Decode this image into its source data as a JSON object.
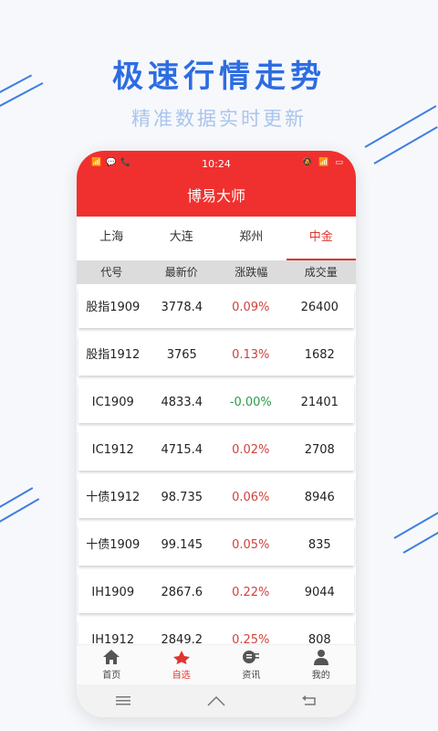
{
  "headline": "极速行情走势",
  "subline": "精准数据实时更新",
  "colors": {
    "brand": "#f0302e",
    "accent": "#2d6de2",
    "up": "#d0423e",
    "flat": "#2f9a45"
  },
  "status": {
    "time": "10:24",
    "left": "📶 💬 📞",
    "right": "🔕 📶 ▭"
  },
  "app": {
    "title": "博易大师"
  },
  "tabs": [
    "上海",
    "大连",
    "郑州",
    "中金"
  ],
  "active_tab": "中金",
  "columns": [
    "代号",
    "最新价",
    "涨跌幅",
    "成交量"
  ],
  "rows": [
    {
      "code": "股指1909",
      "price": "3778.4",
      "change": "0.09%",
      "volume": "26400",
      "dir": "up"
    },
    {
      "code": "股指1912",
      "price": "3765",
      "change": "0.13%",
      "volume": "1682",
      "dir": "up"
    },
    {
      "code": "IC1909",
      "price": "4833.4",
      "change": "-0.00%",
      "volume": "21401",
      "dir": "flat"
    },
    {
      "code": "IC1912",
      "price": "4715.4",
      "change": "0.02%",
      "volume": "2708",
      "dir": "up"
    },
    {
      "code": "十债1912",
      "price": "98.735",
      "change": "0.06%",
      "volume": "8946",
      "dir": "up"
    },
    {
      "code": "十债1909",
      "price": "99.145",
      "change": "0.05%",
      "volume": "835",
      "dir": "up"
    },
    {
      "code": "IH1909",
      "price": "2867.6",
      "change": "0.22%",
      "volume": "9044",
      "dir": "up"
    },
    {
      "code": "IH1912",
      "price": "2849.2",
      "change": "0.25%",
      "volume": "808",
      "dir": "up"
    }
  ],
  "nav": [
    {
      "label": "首页",
      "icon": "home-icon"
    },
    {
      "label": "自选",
      "icon": "favorites-icon"
    },
    {
      "label": "资讯",
      "icon": "news-icon"
    },
    {
      "label": "我的",
      "icon": "user-icon"
    }
  ],
  "active_nav": "自选",
  "system_nav": [
    "menu-icon",
    "home-outline-icon",
    "back-icon"
  ]
}
